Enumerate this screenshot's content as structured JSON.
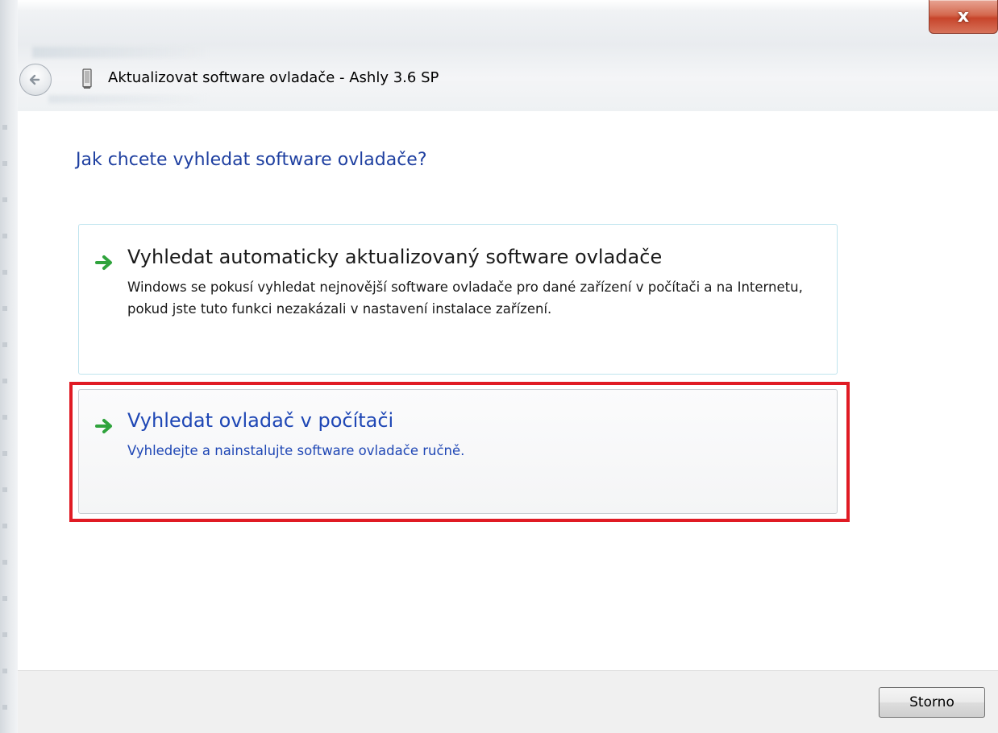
{
  "window": {
    "title": "Aktualizovat software ovladače - Ashly 3.6 SP",
    "close_label": "x"
  },
  "content": {
    "heading": "Jak chcete vyhledat software ovladače?",
    "options": [
      {
        "title": "Vyhledat automaticky aktualizovaný software ovladače",
        "description": "Windows se pokusí vyhledat nejnovější software ovladače pro dané zařízení v počítači a na Internetu, pokud jste tuto funkci nezakázali v nastavení instalace zařízení."
      },
      {
        "title": "Vyhledat ovladač v počítači",
        "description": "Vyhledejte a nainstalujte software ovladače ručně."
      }
    ]
  },
  "footer": {
    "cancel_label": "Storno"
  },
  "icons": {
    "back": "back-arrow-icon",
    "device": "usb-device-icon",
    "option_arrow": "green-arrow-icon"
  },
  "colors": {
    "heading": "#1e3fa0",
    "highlight": "#e01b24",
    "arrow_green": "#2fa33c"
  }
}
